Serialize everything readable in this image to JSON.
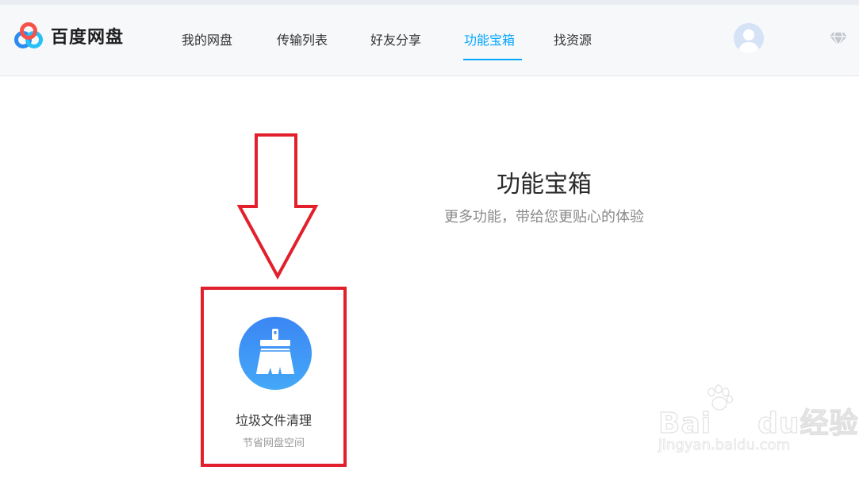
{
  "app": {
    "name": "百度网盘"
  },
  "nav": {
    "items": [
      {
        "label": "我的网盘"
      },
      {
        "label": "传输列表"
      },
      {
        "label": "好友分享"
      },
      {
        "label": "功能宝箱",
        "active": true
      },
      {
        "label": "找资源"
      }
    ]
  },
  "header": {
    "avatar_icon": "user-avatar-icon",
    "vip_icon": "diamond-icon"
  },
  "main": {
    "title": "功能宝箱",
    "subtitle": "更多功能，带给您更贴心的体验",
    "tools": [
      {
        "name": "垃圾文件清理",
        "description": "节省网盘空间",
        "icon": "broom-icon"
      }
    ]
  },
  "annotation": {
    "arrow_color": "#e1202c",
    "highlight_color": "#e1202c"
  },
  "watermark": {
    "brand": "Bai",
    "brand_suffix": "du",
    "product": "经验",
    "url": "jingyan.baidu.com"
  },
  "colors": {
    "accent": "#06a7ff",
    "header_bg": "#f7f8fa",
    "tool_icon_bg": "#3a8ef6"
  }
}
